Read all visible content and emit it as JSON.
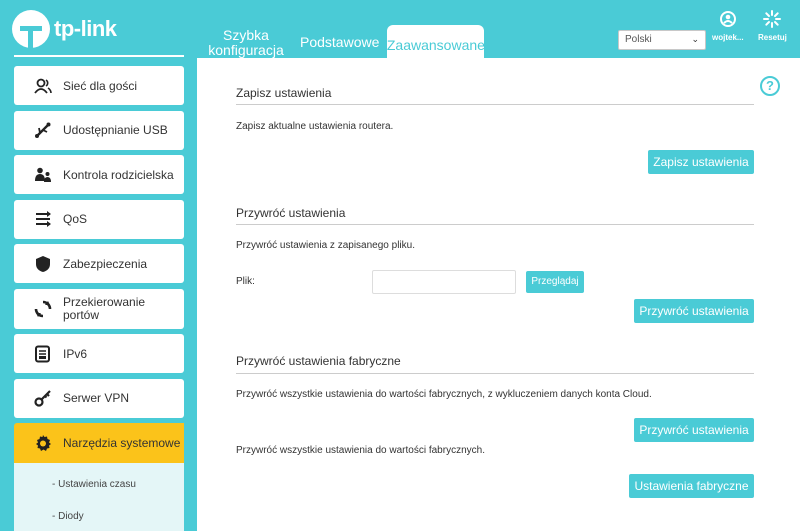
{
  "brand": {
    "name": "tp-link"
  },
  "tabs": [
    {
      "line1": "Szybka",
      "line2": "konfiguracja"
    },
    {
      "label": "Podstawowe"
    },
    {
      "label": "Zaawansowane"
    }
  ],
  "language": {
    "selected": "Polski"
  },
  "header_actions": {
    "account_label": "wojtek...",
    "reset_label": "Resetuj"
  },
  "sidebar": {
    "items": [
      {
        "label": "Sieć dla gości",
        "icon": "guest-network-icon"
      },
      {
        "label": "Udostępnianie USB",
        "icon": "usb-icon"
      },
      {
        "label": "Kontrola rodzicielska",
        "icon": "parental-control-icon"
      },
      {
        "label": "QoS",
        "icon": "qos-icon"
      },
      {
        "label": "Zabezpieczenia",
        "icon": "shield-icon"
      },
      {
        "label_line1": "Przekierowanie",
        "label_line2": "portów",
        "icon": "nat-forwarding-icon"
      },
      {
        "label": "IPv6",
        "icon": "ipv6-icon"
      },
      {
        "label": "Serwer VPN",
        "icon": "vpn-icon"
      },
      {
        "label": "Narzędzia systemowe",
        "icon": "system-tools-icon"
      }
    ],
    "submenu": [
      {
        "label": "- Ustawienia czasu"
      },
      {
        "label": "- Diody"
      }
    ]
  },
  "main": {
    "save": {
      "title": "Zapisz ustawienia",
      "description": "Zapisz aktualne ustawienia routera.",
      "button": "Zapisz ustawienia"
    },
    "restore": {
      "title": "Przywróć ustawienia",
      "description": "Przywróć ustawienia z zapisanego pliku.",
      "file_label": "Plik:",
      "file_value": "",
      "browse_button": "Przeglądaj",
      "button": "Przywróć ustawienia"
    },
    "factory": {
      "title": "Przywróć ustawienia fabryczne",
      "description1": "Przywróć wszystkie ustawienia do wartości fabrycznych, z wykluczeniem danych konta Cloud.",
      "button1": "Przywróć ustawienia",
      "description2": "Przywróć wszystkie ustawienia do wartości fabrycznych.",
      "button2": "Ustawienia fabryczne"
    }
  },
  "colors": {
    "accent": "#4acbd6",
    "active_menu": "#fbc31a",
    "submenu_bg": "#e4f6f7"
  }
}
